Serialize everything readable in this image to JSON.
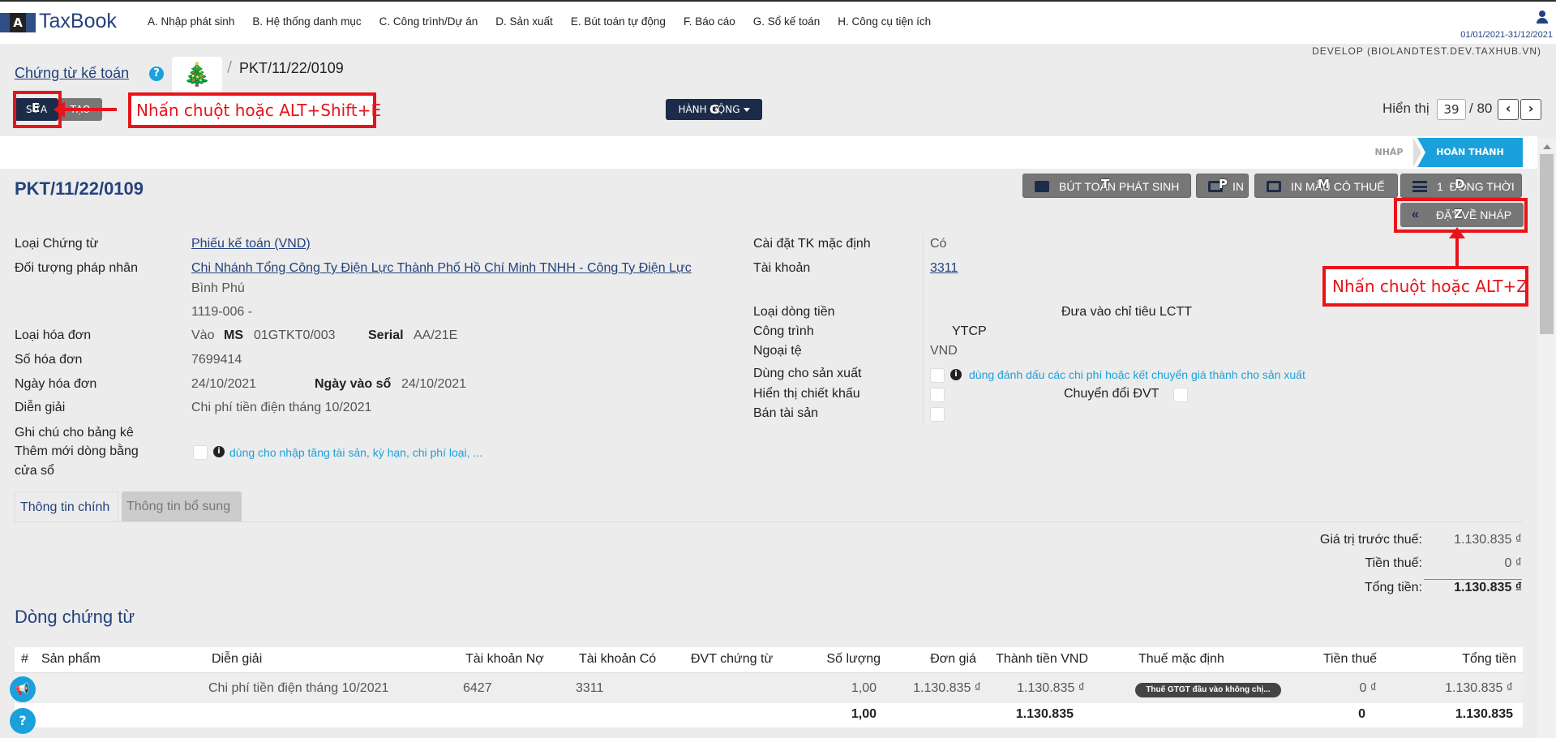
{
  "app": {
    "logo_badge": "A",
    "logo_text": "TaxBook",
    "period": "01/01/2021-31/12/2021",
    "environment": "DEVELOP (BIOLANDTEST.DEV.TAXHUB.VN)"
  },
  "menu": [
    "A. Nhập phát sinh",
    "B. Hệ thống danh mục",
    "C. Công trình/Dự án",
    "D. Sản xuất",
    "E. Bút toán tự động",
    "F. Báo cáo",
    "G. Sổ kế toán",
    "H. Công cụ tiện ích"
  ],
  "breadcrumb": {
    "parent": "Chứng từ kế toán",
    "help": "?",
    "separator": "/",
    "current": "PKT/11/22/0109"
  },
  "actions": {
    "edit": "SỬA",
    "edit_key": "E",
    "create": "TẠO",
    "action_menu": "HÀNH ĐỘNG",
    "action_key": "G"
  },
  "annotations": {
    "edit_hint": "Nhấn chuột hoặc ALT+Shift+E",
    "draft_hint": "Nhấn chuột hoặc ALT+Z"
  },
  "pager": {
    "label": "Hiển thị",
    "current": "39",
    "total": "/ 80",
    "prev": "‹",
    "next": "›"
  },
  "status": {
    "draft": "NHÁP",
    "done": "HOÀN THÀNH"
  },
  "document": {
    "title": "PKT/11/22/0109"
  },
  "toolbar": {
    "post": "BÚT TOÁN PHÁT SINH",
    "post_key": "T",
    "print": "IN",
    "print_key": "P",
    "print_tax": "IN MẪU CÓ THUẾ",
    "print_tax_key": "M",
    "simultaneous_count": "1",
    "simultaneous": "ĐỒNG THỜI",
    "simultaneous_key": "D",
    "set_draft": "ĐẶT VỀ NHÁP",
    "set_draft_key": "Z"
  },
  "form_left": {
    "doc_type_label": "Loại Chứng từ",
    "doc_type_value": "Phiếu kế toán (VND)",
    "entity_label": "Đối tượng pháp nhân",
    "entity_value_1": "Chi Nhánh Tổng Công Ty Điện Lực Thành Phố Hồ Chí Minh TNHH - Công Ty Điện Lực",
    "entity_value_2": "Bình Phú",
    "entity_code": "1119-006 -",
    "invoice_type_label": "Loại hóa đơn",
    "invoice_type_value": "Vào",
    "ms_label": "MS",
    "ms_value": "01GTKT0/003",
    "serial_label": "Serial",
    "serial_value": "AA/21E",
    "invoice_no_label": "Số hóa đơn",
    "invoice_no_value": "7699414",
    "invoice_date_label": "Ngày hóa đơn",
    "invoice_date_value": "24/10/2021",
    "book_date_label": "Ngày vào sổ",
    "book_date_value": "24/10/2021",
    "description_label": "Diễn giải",
    "description_value": "Chi phí tiền điện tháng 10/2021",
    "note_label": "Ghi chú cho bảng kê",
    "add_line_label_1": "Thêm mới dòng bằng",
    "add_line_label_2": "cửa sổ",
    "add_line_hint": "dùng cho nhập tăng tài sản, kỳ hạn, chi phí loại, ..."
  },
  "form_right": {
    "default_account_label": "Cài đặt TK mặc định",
    "default_account_value": "Có",
    "account_label": "Tài khoản",
    "account_value": "3311",
    "cashflow_label": "Loại dòng tiền",
    "cashflow_value": "Đưa vào chỉ tiêu LCTT",
    "project_label": "Công trình",
    "project_value": "YTCP",
    "currency_label": "Ngoại tệ",
    "currency_value": "VND",
    "production_label": "Dùng cho sản xuất",
    "production_hint": "dùng đánh dấu các chi phí hoặc kết chuyển giá thành cho sản xuất",
    "discount_label": "Hiển thị chiết khấu",
    "unit_convert_label": "Chuyển đổi ĐVT",
    "asset_sale_label": "Bán tài sản"
  },
  "tabs": {
    "main": "Thông tin chính",
    "extra": "Thông tin bổ sung"
  },
  "totals": {
    "pretax_label": "Giá trị trước thuế:",
    "pretax_value": "1.130.835 ₫",
    "tax_label": "Tiền thuế:",
    "tax_value": "0 ₫",
    "total_label": "Tổng tiền:",
    "total_value": "1.130.835 ₫"
  },
  "lines": {
    "title": "Dòng chứng từ",
    "headers": {
      "index": "#",
      "product": "Sản phẩm",
      "description": "Diễn giải",
      "debit": "Tài khoản Nợ",
      "credit": "Tài khoản Có",
      "unit": "ĐVT chứng từ",
      "quantity": "Số lượng",
      "price": "Đơn giá",
      "amount": "Thành tiền VND",
      "tax_default": "Thuế mặc định",
      "tax": "Tiền thuế",
      "total": "Tổng tiền"
    },
    "row": {
      "description": "Chi phí tiền điện tháng 10/2021",
      "debit": "6427",
      "credit": "3311",
      "quantity": "1,00",
      "price": "1.130.835 ₫",
      "amount": "1.130.835 ₫",
      "tax_badge": "Thuế GTGT đầu vào không chị...",
      "tax": "0 ₫",
      "total": "1.130.835 ₫"
    },
    "sum": {
      "quantity": "1,00",
      "amount": "1.130.835",
      "tax": "0",
      "total": "1.130.835"
    }
  },
  "fabs": {
    "announce": "📢",
    "help": "?"
  }
}
